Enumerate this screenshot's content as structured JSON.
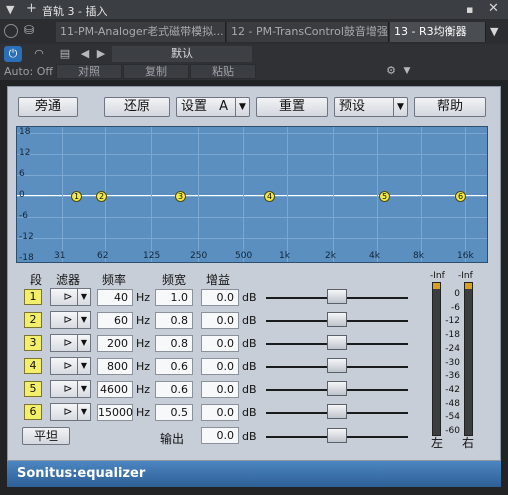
{
  "window": {
    "title": "音轨 3 - 插入",
    "pin_icon": "pin-icon",
    "close_icon": "close-icon"
  },
  "tabs": [
    {
      "label": "11-PM-Analoger老式磁带模拟...",
      "active": false
    },
    {
      "label": "12 - PM-TransControl鼓音增强...",
      "active": false
    },
    {
      "label": "13 - R3均衡器",
      "active": true
    }
  ],
  "toolbar": {
    "preset_name": "默认",
    "auto_label": "Auto: Off",
    "compare_label": "对照",
    "copy_label": "复制",
    "paste_label": "粘贴"
  },
  "eq": {
    "buttons": {
      "bypass": "旁通",
      "restore": "还原",
      "setting": "设置",
      "setting_value": "A",
      "reset": "重置",
      "preset": "预设",
      "help": "帮助",
      "flat": "平坦"
    },
    "graph": {
      "y_ticks": [
        "18",
        "12",
        "6",
        "0",
        "-6",
        "-12",
        "-18"
      ],
      "x_ticks": [
        "31",
        "62",
        "125",
        "250",
        "500",
        "1k",
        "2k",
        "4k",
        "8k",
        "16k"
      ]
    },
    "headers": {
      "band": "段",
      "filter": "滤器",
      "freq": "频率",
      "width": "频宽",
      "gain": "增益",
      "output": "输出"
    },
    "units": {
      "freq": "Hz",
      "gain": "dB"
    },
    "bands": [
      {
        "band": "1",
        "freq": "40",
        "width": "1.0",
        "gain": "0.0"
      },
      {
        "band": "2",
        "freq": "60",
        "width": "0.8",
        "gain": "0.0"
      },
      {
        "band": "3",
        "freq": "200",
        "width": "0.8",
        "gain": "0.0"
      },
      {
        "band": "4",
        "freq": "800",
        "width": "0.6",
        "gain": "0.0"
      },
      {
        "band": "5",
        "freq": "4600",
        "width": "0.6",
        "gain": "0.0"
      },
      {
        "band": "6",
        "freq": "15000",
        "width": "0.5",
        "gain": "0.0"
      }
    ],
    "output_gain": "0.0",
    "meters": {
      "left_peak": "-Inf",
      "right_peak": "-Inf",
      "scale": [
        "0",
        "-6",
        "-12",
        "-18",
        "-24",
        "-30",
        "-36",
        "-42",
        "-48",
        "-54",
        "-60"
      ],
      "left_label": "左",
      "right_label": "右"
    },
    "brand": "Sonitus:equalizer"
  }
}
